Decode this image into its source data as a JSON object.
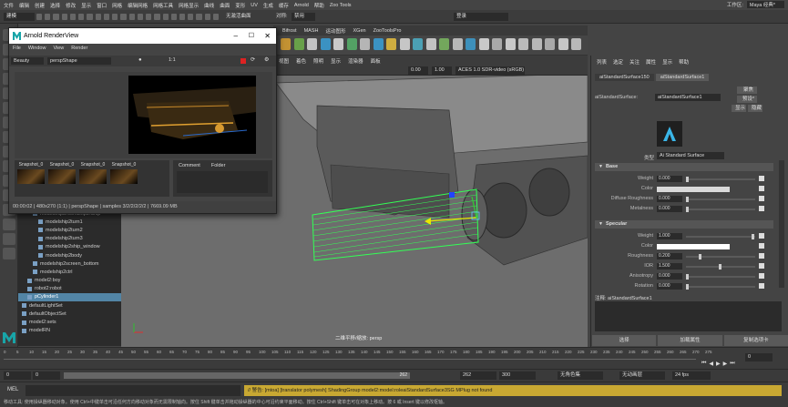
{
  "menubar": [
    "文件",
    "编辑",
    "创建",
    "选择",
    "修改",
    "显示",
    "窗口",
    "网格",
    "编辑网格",
    "网格工具",
    "网格显示",
    "曲线",
    "曲面",
    "变形",
    "UV",
    "生成",
    "缓存",
    "Arnold",
    "帮助",
    "Zoo Tools"
  ],
  "workspace": {
    "label": "工作区:",
    "value": "Maya 经典*"
  },
  "status": {
    "mode": "建模",
    "no_live": "无激活曲面",
    "symmetry_label": "对称:",
    "symmetry_value": "禁用",
    "login": "登录"
  },
  "shelf_tabs": [
    "Bifrost",
    "MASH",
    "运动图形",
    "XGen",
    "ZooToolsPro"
  ],
  "viewport": {
    "menu": [
      "视图",
      "着色",
      "照明",
      "显示",
      "渲染器",
      "面板"
    ],
    "gamma": "0.00",
    "exposure": "1.00",
    "color_mgmt": "ACES 1.0 SDR-video (sRGB)",
    "camera_label": "二维平移/缩放: persp"
  },
  "outliner": {
    "items": [
      {
        "label": "modelship2roomship3:Ship",
        "indent": 2,
        "selected": false
      },
      {
        "label": "modelship2turn1",
        "indent": 3,
        "selected": false
      },
      {
        "label": "modelship2turn2",
        "indent": 3,
        "selected": false
      },
      {
        "label": "modelship2turn3",
        "indent": 3,
        "selected": false
      },
      {
        "label": "modelship2ship_window",
        "indent": 3,
        "selected": false
      },
      {
        "label": "modelship2body",
        "indent": 3,
        "selected": false
      },
      {
        "label": "modelship2screen_bottom",
        "indent": 2,
        "selected": false
      },
      {
        "label": "modelship2ctrl",
        "indent": 2,
        "selected": false
      },
      {
        "label": "model2:boy",
        "indent": 1,
        "selected": false
      },
      {
        "label": "robot2:robot",
        "indent": 1,
        "selected": false
      },
      {
        "label": "pCylinder1",
        "indent": 1,
        "selected": true
      },
      {
        "label": "defaultLightSet",
        "indent": 0,
        "selected": false
      },
      {
        "label": "defaultObjectSet",
        "indent": 0,
        "selected": false
      },
      {
        "label": "model2:sets",
        "indent": 0,
        "selected": false
      },
      {
        "label": "modelRN",
        "indent": 0,
        "selected": false
      }
    ]
  },
  "renderview": {
    "title": "Arnold RenderView",
    "menu": [
      "File",
      "Window",
      "View",
      "Render"
    ],
    "aov": "Beauty",
    "camera": "perspShape",
    "ratio": "1:1",
    "snapshots": [
      "Snapshot_0",
      "Snapshot_0",
      "Snapshot_0",
      "Snapshot_0"
    ],
    "tabs": [
      "Comment",
      "Folder"
    ],
    "status": "00:00:02 | 480x270 (1:1) | perspShape | samples 3/2/2/2/2/2 | 7669.09 MB"
  },
  "attribute_editor": {
    "tabs": [
      "列表",
      "选定",
      "关注",
      "属性",
      "显示",
      "帮助"
    ],
    "node_tabs": [
      "aiStandardSurface150",
      "aiStandardSurface1"
    ],
    "node_label": "aiStandardSurface:",
    "node_name": "aiStandardSurface1",
    "focus_btn": "聚焦",
    "preset_btn": "预设*",
    "show_btn": "显示",
    "hide_btn": "隐藏",
    "type_label": "类型",
    "type_value": "Ai Standard Surface",
    "sections": {
      "base": {
        "title": "Base",
        "attrs": [
          {
            "label": "Weight",
            "value": "0.000",
            "slider": 0.0
          },
          {
            "label": "Color",
            "color": "#d9d9d9"
          },
          {
            "label": "Diffuse Roughness",
            "value": "0.000",
            "slider": 0.0
          },
          {
            "label": "Metalness",
            "value": "0.000",
            "slider": 0.0
          }
        ]
      },
      "specular": {
        "title": "Specular",
        "attrs": [
          {
            "label": "Weight",
            "value": "1.000",
            "slider": 1.0
          },
          {
            "label": "Color",
            "color": "#ffffff"
          },
          {
            "label": "Roughness",
            "value": "0.200",
            "slider": 0.2
          },
          {
            "label": "IOR",
            "value": "1.500",
            "slider": 0.5
          },
          {
            "label": "Anisotropy",
            "value": "0.000",
            "slider": 0.0
          },
          {
            "label": "Rotation",
            "value": "0.000",
            "slider": 0.0
          }
        ]
      }
    },
    "notes_label": "注释: aiStandardSurface1",
    "buttons": [
      "选择",
      "加载属性",
      "复制选项卡"
    ]
  },
  "time": {
    "ticks": [
      "0",
      "5",
      "10",
      "15",
      "20",
      "25",
      "30",
      "35",
      "40",
      "45",
      "50",
      "55",
      "60",
      "65",
      "70",
      "75",
      "80",
      "85",
      "90",
      "95",
      "100",
      "105",
      "110",
      "115",
      "120",
      "125",
      "130",
      "135",
      "140",
      "145",
      "150",
      "155",
      "160",
      "165",
      "170",
      "175",
      "180",
      "185",
      "190",
      "195",
      "200",
      "205",
      "210",
      "215",
      "220",
      "225",
      "230",
      "235",
      "240",
      "245",
      "250",
      "255",
      "260",
      "265",
      "270",
      "275"
    ],
    "current": "0",
    "range_start": "0",
    "range_start2": "0",
    "range_mid": "262",
    "range_end": "262",
    "range_end2": "300",
    "char_set": "无角色集",
    "anim_layer": "无动画层",
    "fps": "24 fps"
  },
  "cmdline": {
    "label": "MEL",
    "warning": "// 警告: [mtoa] [translator polymesh] ShadingGroup model2:model:roleaiStandardSurface3SG MPlug not found"
  },
  "helpline": "移动工具: 使用操纵器移动对象。使用 Ctrl+中键单击可沿任何方向移动对象而无需限制轴向。按住 Shift 键单击并拖动操纵器的中心可沿约束平面移动。按住 Ctrl+Shift 键单击可在对象上移动。按 6 或 Insert 键以修改枢轴。"
}
